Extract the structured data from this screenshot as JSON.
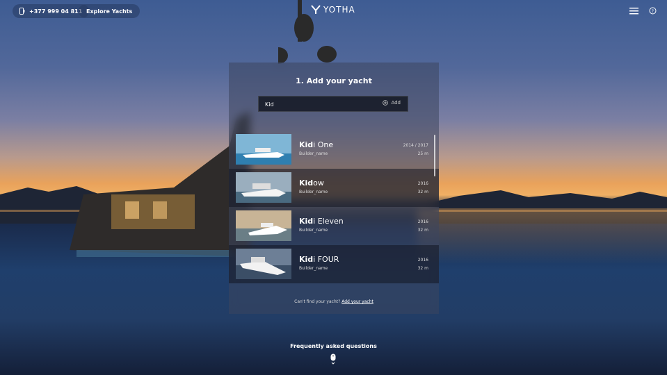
{
  "header": {
    "phone": "+377 999 04 811",
    "explore_label": "Explore Yachts",
    "brand": "YOTHA",
    "icons": [
      "phone-icon",
      "logo-mark-icon",
      "menu-icon",
      "help-icon"
    ]
  },
  "modal": {
    "title": "1. Add your yacht",
    "search_value": "Kid",
    "add_label": "Add",
    "results": [
      {
        "match": "Kid",
        "rest": "i One",
        "builder": "Builder_name",
        "year": "2014 / 2017",
        "length": "25 m"
      },
      {
        "match": "Kid",
        "rest": "ow",
        "builder": "Builder_name",
        "year": "2016",
        "length": "32 m"
      },
      {
        "match": "Kid",
        "rest": "i Eleven",
        "builder": "Builder_name",
        "year": "2016",
        "length": "32 m"
      },
      {
        "match": "Kid",
        "rest": "i FOUR",
        "builder": "Builder_name",
        "year": "2016",
        "length": "32 m"
      }
    ],
    "footer_text": "Can't find your yacht?",
    "footer_link": "Add your yacht"
  },
  "faq_label": "Frequently asked questions",
  "colors": {
    "sunset": "#f0b064",
    "sea": "#1f3f6c",
    "sky": "#3e5c93"
  }
}
